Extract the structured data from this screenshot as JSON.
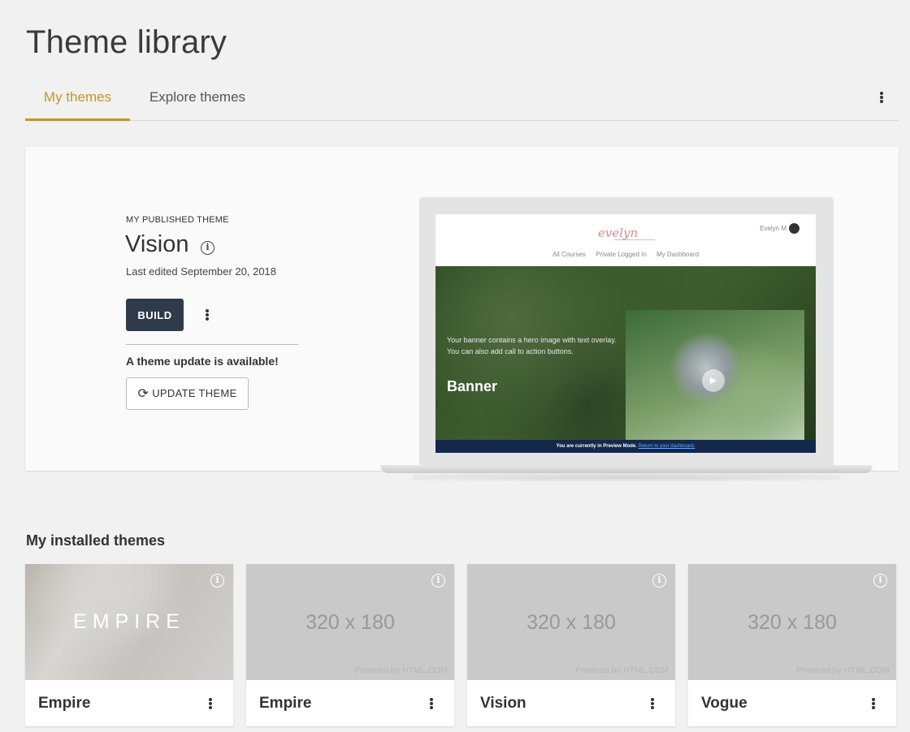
{
  "page": {
    "title": "Theme library"
  },
  "tabs": [
    {
      "label": "My themes",
      "active": true
    },
    {
      "label": "Explore themes",
      "active": false
    }
  ],
  "published": {
    "kicker": "MY PUBLISHED THEME",
    "name": "Vision",
    "last_edited": "Last edited September 20, 2018",
    "build_label": "BUILD",
    "update_note": "A theme update is available!",
    "update_label": "UPDATE THEME",
    "preview": {
      "logo": "evelyn",
      "user": "Evelyn M",
      "nav": [
        "All Courses",
        "Private Logged In",
        "My Dashboard"
      ],
      "banner_text": "Your banner contains a hero image with text overlay. You can also add call to action buttons.",
      "banner_title": "Banner",
      "footer_text": "You are currently in Preview Mode.",
      "footer_link": "Return to your dashboard."
    }
  },
  "installed": {
    "title": "My installed themes",
    "themes": [
      {
        "name": "Empire",
        "thumb_word": "EMPIRE"
      },
      {
        "name": "Empire",
        "placeholder": "320 x 180",
        "powered": "Powered by HTML.COM"
      },
      {
        "name": "Vision",
        "placeholder": "320 x 180",
        "powered": "Powered by HTML.COM"
      },
      {
        "name": "Vogue",
        "placeholder": "320 x 180",
        "powered": "Powered by HTML.COM"
      }
    ]
  },
  "colors": {
    "accent": "#c2962a",
    "build_button": "#2f3b4a",
    "background": "#f1f1f1"
  }
}
